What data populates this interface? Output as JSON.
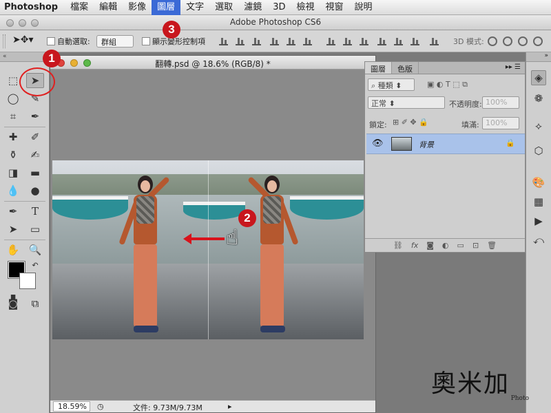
{
  "menubar": {
    "app": "Photoshop",
    "items": [
      "檔案",
      "編輯",
      "影像",
      "圖層",
      "文字",
      "選取",
      "濾鏡",
      "3D",
      "檢視",
      "視窗",
      "說明"
    ],
    "active_index": 3
  },
  "window": {
    "title": "Adobe Photoshop CS6"
  },
  "options": {
    "auto_select_label": "自動選取:",
    "auto_select_value": "群組",
    "show_transform_label": "顯示變形控制項",
    "mode_3d_label": "3D 模式:"
  },
  "document": {
    "title": "翻轉.psd @ 18.6% (RGB/8) *",
    "zoom": "18.59%",
    "file_info": "文件: 9.73M/9.73M"
  },
  "layers_panel": {
    "tabs": [
      "圖層",
      "色版"
    ],
    "kind_filter": "種類",
    "blend_mode": "正常",
    "opacity_label": "不透明度:",
    "opacity_value": "100%",
    "lock_label": "鎖定:",
    "fill_label": "填滿:",
    "fill_value": "100%",
    "layer_name": "背景"
  },
  "annotations": {
    "step1": "1",
    "step2": "2",
    "step3": "3"
  },
  "watermark": {
    "text": "奧米加",
    "sub": "Photo"
  },
  "colors": {
    "accent_red": "#c8161d",
    "menu_highlight": "#3b6ad6",
    "selected_layer": "#a9c2ea"
  }
}
